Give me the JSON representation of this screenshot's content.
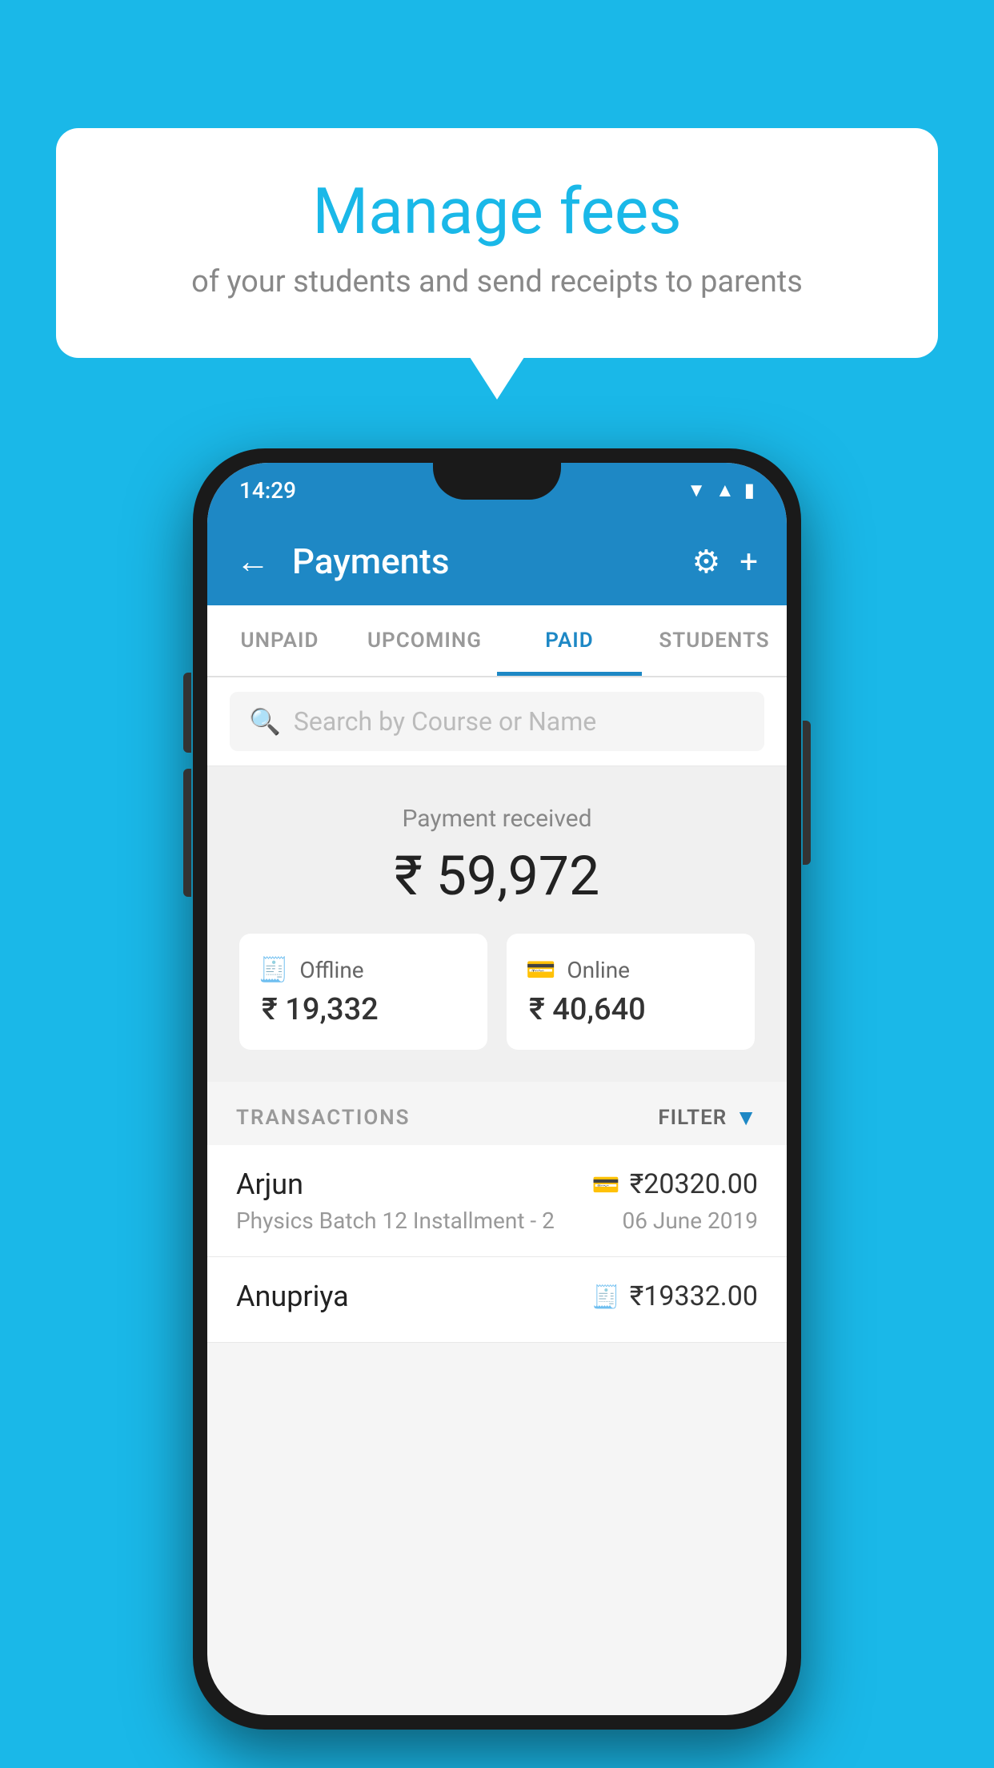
{
  "background_color": "#1ab8e8",
  "bubble": {
    "title": "Manage fees",
    "subtitle": "of your students and send receipts to parents"
  },
  "status_bar": {
    "time": "14:29",
    "wifi": "▲",
    "signal": "▲",
    "battery": "▐"
  },
  "app_bar": {
    "title": "Payments",
    "back_icon": "←",
    "gear_icon": "⚙",
    "plus_icon": "+"
  },
  "tabs": [
    {
      "label": "UNPAID",
      "active": false
    },
    {
      "label": "UPCOMING",
      "active": false
    },
    {
      "label": "PAID",
      "active": true
    },
    {
      "label": "STUDENTS",
      "active": false
    }
  ],
  "search": {
    "placeholder": "Search by Course or Name"
  },
  "payment_summary": {
    "label": "Payment received",
    "total_amount": "₹ 59,972",
    "offline": {
      "label": "Offline",
      "amount": "₹ 19,332"
    },
    "online": {
      "label": "Online",
      "amount": "₹ 40,640"
    }
  },
  "transactions": {
    "header_label": "TRANSACTIONS",
    "filter_label": "FILTER",
    "rows": [
      {
        "name": "Arjun",
        "amount": "₹20320.00",
        "payment_type": "online",
        "course": "Physics Batch 12 Installment - 2",
        "date": "06 June 2019"
      },
      {
        "name": "Anupriya",
        "amount": "₹19332.00",
        "payment_type": "offline",
        "course": "",
        "date": ""
      }
    ]
  }
}
